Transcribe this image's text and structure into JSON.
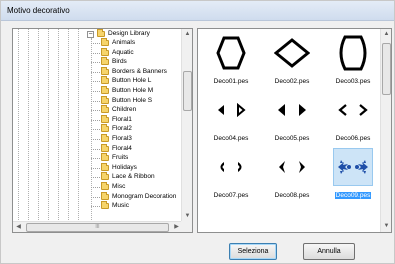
{
  "window": {
    "title": "Motivo decorativo"
  },
  "tree": {
    "root_label": "Design Library",
    "expander": "−",
    "items": [
      "Animals",
      "Aquatic",
      "Birds",
      "Borders & Banners",
      "Button Hole L",
      "Button Hole M",
      "Button Hole S",
      "Children",
      "Floral1",
      "Floral2",
      "Floral3",
      "Floral4",
      "Fruits",
      "Holidays",
      "Lace & Ribbon",
      "Misc",
      "Monogram Decoration",
      "Music"
    ],
    "hscroll_grip": "III"
  },
  "grid": {
    "items": [
      {
        "name": "Deco01.pes",
        "icon": "hexagon-outline-icon"
      },
      {
        "name": "Deco02.pes",
        "icon": "diamond-outline-icon"
      },
      {
        "name": "Deco03.pes",
        "icon": "octagon-outline-icon"
      },
      {
        "name": "Deco04.pes",
        "icon": "triangle-pair-icon"
      },
      {
        "name": "Deco05.pes",
        "icon": "solid-triangle-pair-icon"
      },
      {
        "name": "Deco06.pes",
        "icon": "chevron-pair-icon"
      },
      {
        "name": "Deco07.pes",
        "icon": "curved-chevron-pair-icon"
      },
      {
        "name": "Deco08.pes",
        "icon": "notched-arrow-pair-icon"
      },
      {
        "name": "Deco09.pes",
        "icon": "floral-pair-icon",
        "selected": true
      }
    ]
  },
  "buttons": {
    "select": "Seleziona",
    "cancel": "Annulla"
  },
  "colors": {
    "selection": "#3399ff",
    "icon_fill": "#000000",
    "floral": "#1f4fa8"
  }
}
